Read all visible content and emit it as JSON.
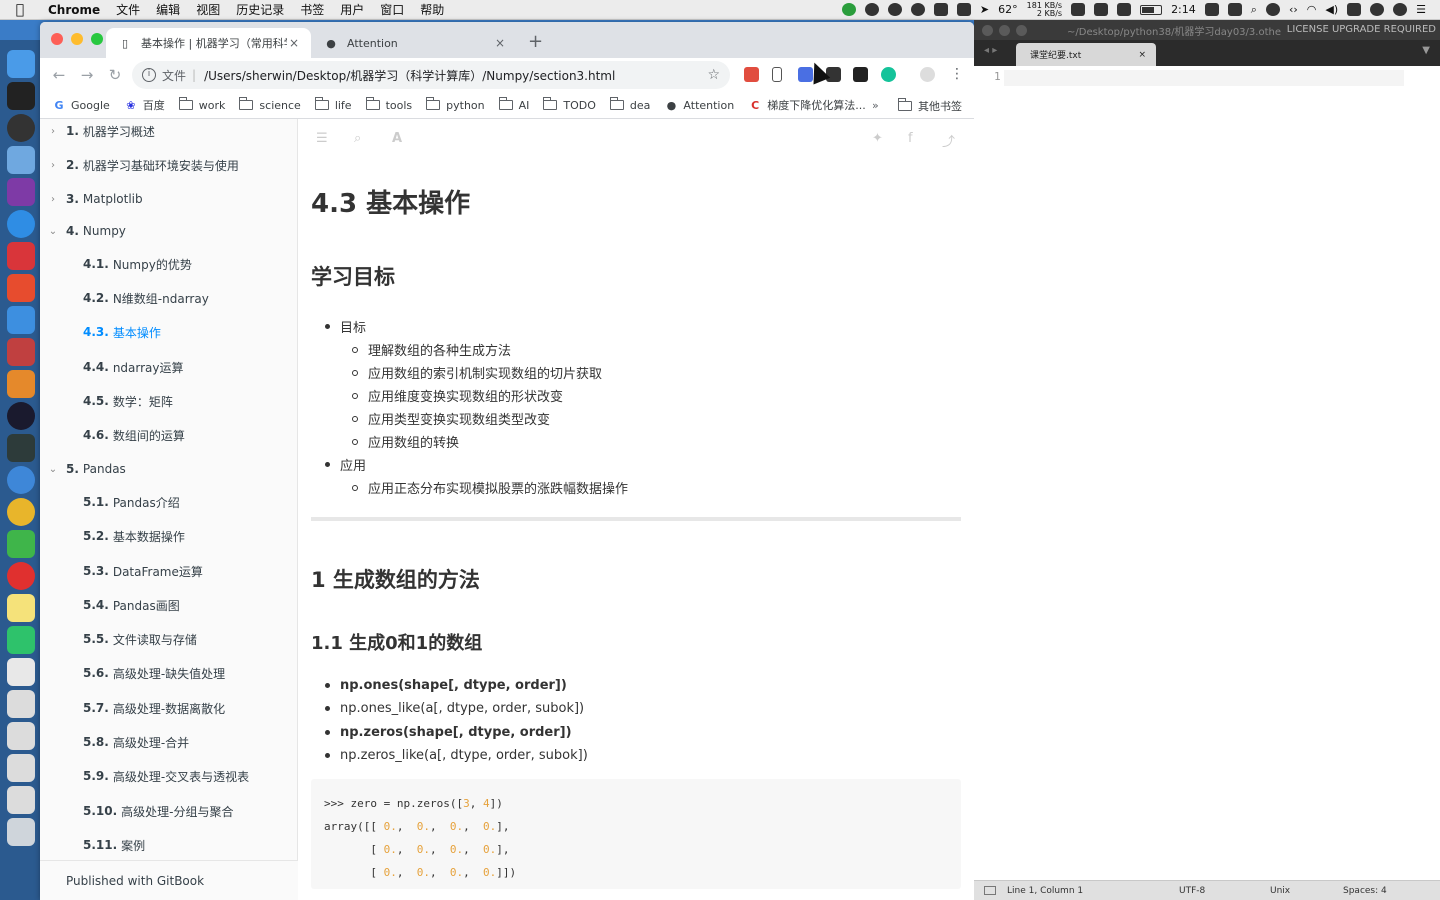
{
  "menubar": {
    "app": "Chrome",
    "items": [
      "文件",
      "编辑",
      "视图",
      "历史记录",
      "书签",
      "用户",
      "窗口",
      "帮助"
    ],
    "temperature": "62°",
    "net_up": "181 KB/s",
    "net_down": "2 KB/s",
    "time": "2:14"
  },
  "browser": {
    "tabs": [
      {
        "title": "基本操作 | 机器学习（常用科学",
        "icon": "book-icon"
      },
      {
        "title": "Attention",
        "icon": "github-icon"
      }
    ],
    "address": {
      "scheme": "文件",
      "url": "/Users/sherwin/Desktop/机器学习（科学计算库）/Numpy/section3.html"
    },
    "bookmarks": [
      "Google",
      "百度",
      "work",
      "science",
      "life",
      "tools",
      "python",
      "AI",
      "TODO",
      "dea",
      "Attention",
      "梯度下降优化算法..."
    ],
    "bookmarks_more": "»",
    "other_bookmarks": "其他书签"
  },
  "summary": {
    "items": [
      {
        "num": "1.",
        "label": "机器学习概述",
        "level": 0,
        "caret": "›"
      },
      {
        "num": "2.",
        "label": "机器学习基础环境安装与使用",
        "level": 0,
        "caret": "›"
      },
      {
        "num": "3.",
        "label": "Matplotlib",
        "level": 0,
        "caret": "›"
      },
      {
        "num": "4.",
        "label": "Numpy",
        "level": 0,
        "caret": "⌄"
      },
      {
        "num": "4.1.",
        "label": "Numpy的优势",
        "level": 1
      },
      {
        "num": "4.2.",
        "label": "N维数组-ndarray",
        "level": 1
      },
      {
        "num": "4.3.",
        "label": "基本操作",
        "level": 1,
        "active": true
      },
      {
        "num": "4.4.",
        "label": "ndarray运算",
        "level": 1
      },
      {
        "num": "4.5.",
        "label": "数学：矩阵",
        "level": 1
      },
      {
        "num": "4.6.",
        "label": "数组间的运算",
        "level": 1
      },
      {
        "num": "5.",
        "label": "Pandas",
        "level": 0,
        "caret": "⌄"
      },
      {
        "num": "5.1.",
        "label": "Pandas介绍",
        "level": 1
      },
      {
        "num": "5.2.",
        "label": "基本数据操作",
        "level": 1
      },
      {
        "num": "5.3.",
        "label": "DataFrame运算",
        "level": 1
      },
      {
        "num": "5.4.",
        "label": "Pandas画图",
        "level": 1
      },
      {
        "num": "5.5.",
        "label": "文件读取与存储",
        "level": 1
      },
      {
        "num": "5.6.",
        "label": "高级处理-缺失值处理",
        "level": 1
      },
      {
        "num": "5.7.",
        "label": "高级处理-数据离散化",
        "level": 1
      },
      {
        "num": "5.8.",
        "label": "高级处理-合并",
        "level": 1
      },
      {
        "num": "5.9.",
        "label": "高级处理-交叉表与透视表",
        "level": 1
      },
      {
        "num": "5.10.",
        "label": "高级处理-分组与聚合",
        "level": 1
      },
      {
        "num": "5.11.",
        "label": "案例",
        "level": 1
      }
    ],
    "published": "Published with GitBook"
  },
  "page": {
    "title": "4.3 基本操作",
    "goals_heading": "学习目标",
    "goal_label": "目标",
    "goals": [
      "理解数组的各种生成方法",
      "应用数组的索引机制实现数组的切片获取",
      "应用维度变换实现数组的形状改变",
      "应用类型变换实现数组类型改变",
      "应用数组的转换"
    ],
    "apply_label": "应用",
    "applies": [
      "应用正态分布实现模拟股票的涨跌幅数据操作"
    ],
    "section1": "1 生成数组的方法",
    "section11": "1.1 生成0和1的数组",
    "apis": [
      {
        "text": "np.ones(shape[, dtype, order])",
        "bold": true
      },
      {
        "text": "np.ones_like(a[, dtype, order, subok])",
        "bold": false
      },
      {
        "text": "np.zeros(shape[, dtype, order])",
        "bold": true
      },
      {
        "text": "np.zeros_like(a[, dtype, order, subok])",
        "bold": false
      }
    ],
    "code": {
      "line1_pre": ">>> zero = np.zeros([",
      "line1_a": "3",
      "line1_mid": ", ",
      "line1_b": "4",
      "line1_post": "])",
      "row_open1": "array([[ ",
      "row_open": "       [ ",
      "zero": "0.",
      "comma": ",  ",
      "row_close": "],",
      "row_close_last": "]])"
    }
  },
  "editor": {
    "title_path": "~/Desktop/python38/机器学习day03/3.othe",
    "license": "LICENSE UPGRADE REQUIRED",
    "tab": "课堂纪要.txt",
    "line_number": "1",
    "status": {
      "position": "Line 1, Column 1",
      "encoding": "UTF-8",
      "line_endings": "Unix",
      "spaces": "Spaces: 4"
    }
  }
}
